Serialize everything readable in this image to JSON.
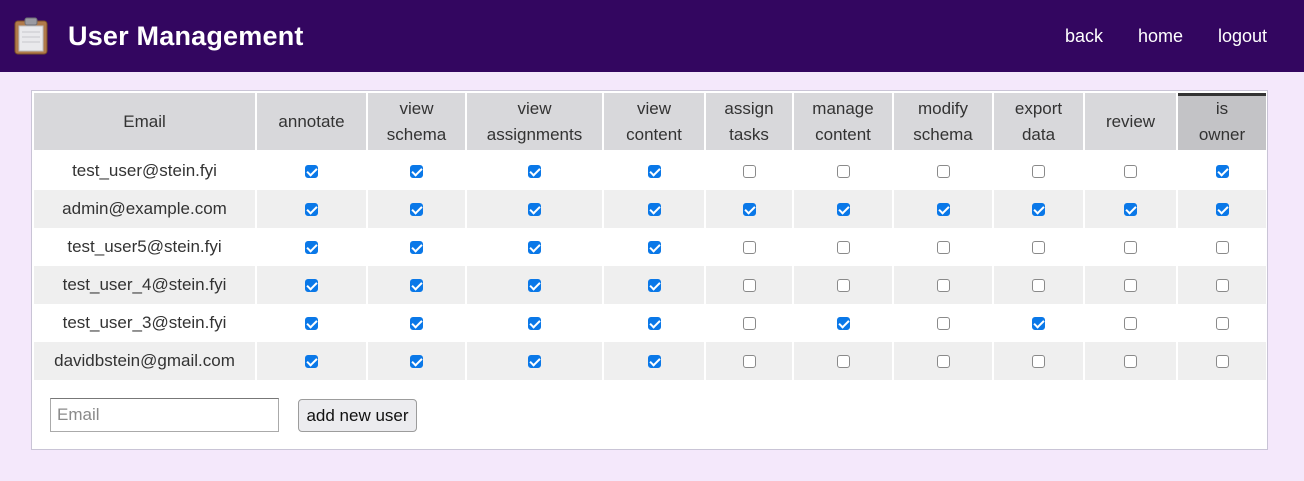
{
  "header": {
    "title": "User Management",
    "logo_icon": "clipboard-icon",
    "nav": {
      "back": "back",
      "home": "home",
      "logout": "logout"
    },
    "bg_color": "#330660"
  },
  "table": {
    "email_header": "Email",
    "permissions": [
      {
        "key": "annotate",
        "line1": "annotate",
        "line2": ""
      },
      {
        "key": "view_schema",
        "line1": "view",
        "line2": "schema"
      },
      {
        "key": "view_assignments",
        "line1": "view",
        "line2": "assignments"
      },
      {
        "key": "view_content",
        "line1": "view",
        "line2": "content"
      },
      {
        "key": "assign_tasks",
        "line1": "assign",
        "line2": "tasks"
      },
      {
        "key": "manage_content",
        "line1": "manage",
        "line2": "content"
      },
      {
        "key": "modify_schema",
        "line1": "modify",
        "line2": "schema"
      },
      {
        "key": "export_data",
        "line1": "export",
        "line2": "data"
      },
      {
        "key": "review",
        "line1": "review",
        "line2": ""
      },
      {
        "key": "is_owner",
        "line1": "is",
        "line2": "owner"
      }
    ],
    "sorted_column": "is_owner",
    "rows": [
      {
        "email": "test_user@stein.fyi",
        "checks": [
          true,
          true,
          true,
          true,
          false,
          false,
          false,
          false,
          false,
          true
        ]
      },
      {
        "email": "admin@example.com",
        "checks": [
          true,
          true,
          true,
          true,
          true,
          true,
          true,
          true,
          true,
          true
        ]
      },
      {
        "email": "test_user5@stein.fyi",
        "checks": [
          true,
          true,
          true,
          true,
          false,
          false,
          false,
          false,
          false,
          false
        ]
      },
      {
        "email": "test_user_4@stein.fyi",
        "checks": [
          true,
          true,
          true,
          true,
          false,
          false,
          false,
          false,
          false,
          false
        ]
      },
      {
        "email": "test_user_3@stein.fyi",
        "checks": [
          true,
          true,
          true,
          true,
          false,
          true,
          false,
          true,
          false,
          false
        ]
      },
      {
        "email": "davidbstein@gmail.com",
        "checks": [
          true,
          true,
          true,
          true,
          false,
          false,
          false,
          false,
          false,
          false
        ]
      }
    ]
  },
  "add_user": {
    "placeholder": "Email",
    "value": "",
    "button_label": "add new user"
  },
  "colors": {
    "page_bg": "#f4e8fb",
    "checkbox_checked": "#0a78e8"
  }
}
